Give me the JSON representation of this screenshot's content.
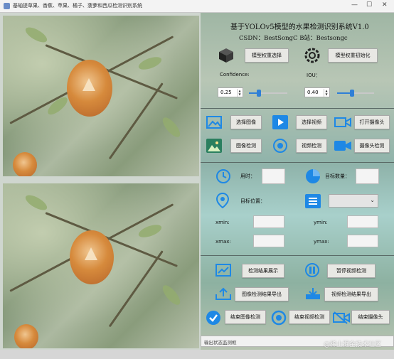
{
  "window": {
    "title": "基轴提草果、香蕉、苹果、橘子、菠萝和西瓜检测识别系统",
    "minimize": "—",
    "maximize": "☐",
    "close": "✕"
  },
  "header": {
    "title": "基于YOLOv5模型的水果检测识别系统V1.0",
    "credits": "CSDN：BestSongC   B站：Bestsongc"
  },
  "model": {
    "select_label": "模型权重选择",
    "init_label": "模型权重初始化"
  },
  "params": {
    "confidence_label": "Confidence:",
    "iou_label": "IOU：",
    "confidence_value": "0.25",
    "iou_value": "0.40",
    "confidence_level": 0.25,
    "iou_level": 0.4
  },
  "input_buttons": {
    "select_image": "选择图像",
    "select_video": "选择视频",
    "open_camera": "打开摄像头",
    "image_detect": "图像检测",
    "video_detect": "视频检测",
    "camera_detect": "摄像头检测"
  },
  "results": {
    "time_label": "用时：",
    "count_label": "目标数量：",
    "position_label": "目标位置：",
    "xmin_label": "xmin:",
    "ymin_label": "ymin:",
    "xmax_label": "xmax:",
    "ymax_label": "ymax:"
  },
  "action_buttons": {
    "show_results": "检测结果展示",
    "pause_video": "暂停视频检测",
    "export_image": "图像检测结果导出",
    "export_video": "视频检测结果导出",
    "end_image": "结束图像检测",
    "end_video": "结束视频检测",
    "end_camera": "结束摄像头"
  },
  "status": {
    "placeholder": "输出状态监测框"
  },
  "watermark": "@稀土掘金技术社区",
  "colors": {
    "accent": "#2f7fd6",
    "icon_blue": "#1e88e5",
    "button_bg": "#e8e8e4"
  },
  "icons": [
    "cube-icon",
    "gear-icon",
    "image-icon",
    "play-icon",
    "camera-icon",
    "picture-icon",
    "video-detect-icon",
    "video-camera-icon",
    "clock-icon",
    "pie-chart-icon",
    "location-icon",
    "list-icon",
    "chart-icon",
    "pause-icon",
    "upload-icon",
    "download-icon",
    "check-icon",
    "stop-icon",
    "camera-off-icon"
  ]
}
